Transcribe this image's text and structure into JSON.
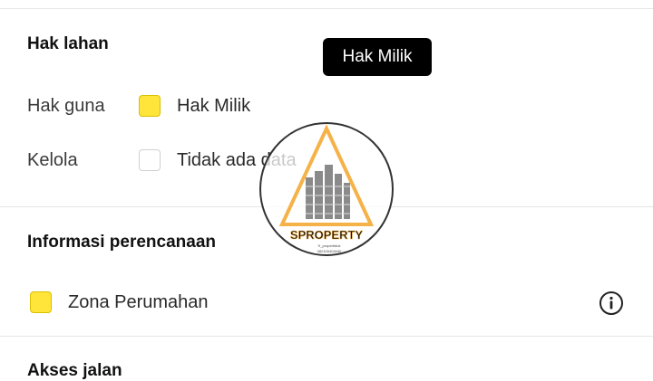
{
  "tooltip": {
    "text": "Hak Milik"
  },
  "land_rights": {
    "title": "Hak lahan",
    "rows": [
      {
        "label": "Hak guna",
        "value": "Hak Milik",
        "checked": true
      },
      {
        "label": "Kelola",
        "value": "Tidak ada data",
        "checked": false
      }
    ]
  },
  "planning": {
    "title": "Informasi perencanaan",
    "zone": {
      "label": "Zona Perumahan",
      "checked": true
    }
  },
  "road_access": {
    "title": "Akses jalan"
  },
  "watermark": {
    "brand": "SPROPERTY",
    "handle": "S_propertiduk",
    "phone": "082100404040"
  },
  "colors": {
    "accent_yellow": "#ffe43a",
    "tooltip_bg": "#000000",
    "watermark_orange": "#f5b248"
  },
  "icons": {
    "info": "info-circle-icon"
  }
}
